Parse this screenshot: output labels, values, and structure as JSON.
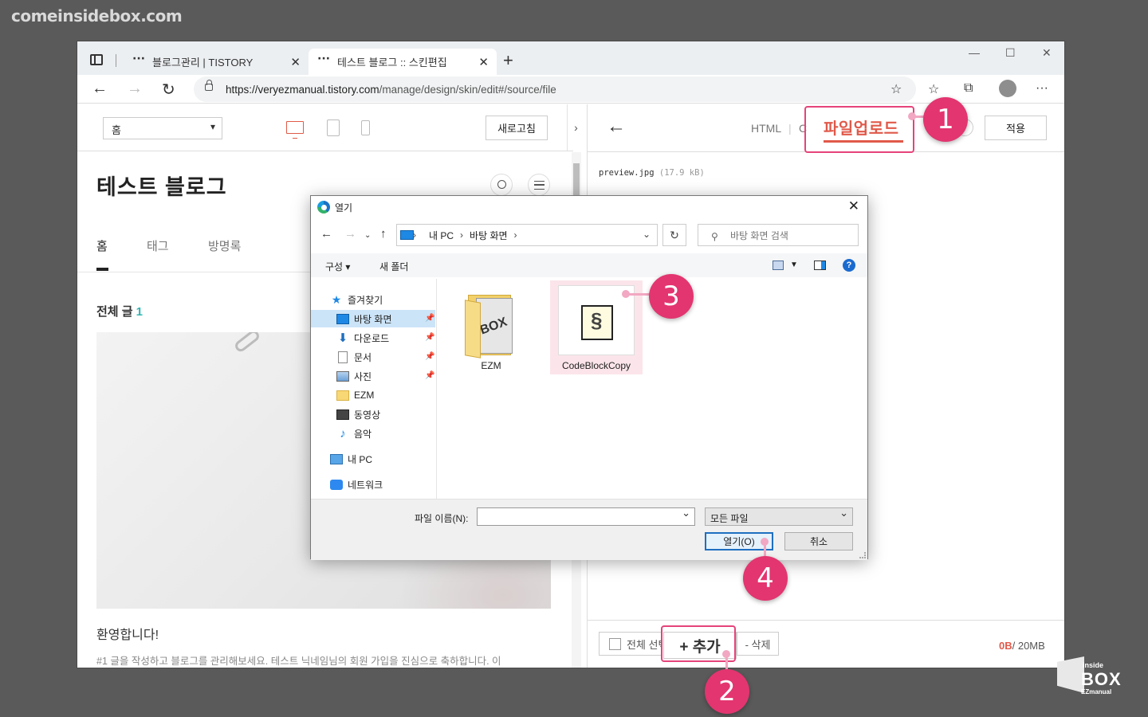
{
  "watermark": "comeinsidebox.com",
  "browser": {
    "tabs": [
      {
        "label": "블로그관리 | TISTORY",
        "active": false
      },
      {
        "label": "테스트 블로그 :: 스킨편집",
        "active": true
      }
    ],
    "url_host": "https://veryezmanual.tistory.com",
    "url_path": "/manage/design/skin/edit#/source/file"
  },
  "preview": {
    "page_select": "홈",
    "refresh_label": "새로고침",
    "blog_title": "테스트 블로그",
    "nav": [
      "홈",
      "태그",
      "방명록"
    ],
    "total_label": "전체 글",
    "total_count": "1",
    "welcome": "환영합니다!",
    "excerpt": "#1 글을 작성하고 블로그를 관리해보세요. 테스트 닉네임님의 회원 가입을 진심으로 축하합니다. 이"
  },
  "editor": {
    "modes": [
      "HTML",
      "C"
    ],
    "upload_tab": "파일업로드",
    "apply_label": "적용",
    "files": [
      {
        "name": "preview.jpg",
        "size": "(17.9 kB)"
      }
    ],
    "select_all": "전체 선택",
    "add_label": "+ 추가",
    "delete_label": "- 삭제",
    "storage_used": "0B",
    "storage_total": "/ 20MB"
  },
  "dialog": {
    "title": "열기",
    "path": [
      "내 PC",
      "바탕 화면"
    ],
    "search_placeholder": "바탕 화면 검색",
    "organize": "구성 ▾",
    "new_folder": "새 폴더",
    "sidebar": [
      {
        "label": "즐겨찾기",
        "icon": "star-icon"
      },
      {
        "label": "바탕 화면",
        "icon": "desktop-icon",
        "pinned": true,
        "selected": true
      },
      {
        "label": "다운로드",
        "icon": "download-icon",
        "pinned": true
      },
      {
        "label": "문서",
        "icon": "document-icon",
        "pinned": true
      },
      {
        "label": "사진",
        "icon": "pictures-icon",
        "pinned": true
      },
      {
        "label": "EZM",
        "icon": "folder-icon"
      },
      {
        "label": "동영상",
        "icon": "video-icon"
      },
      {
        "label": "음악",
        "icon": "music-icon"
      },
      {
        "label": "내 PC",
        "icon": "pc-icon"
      },
      {
        "label": "네트워크",
        "icon": "network-icon"
      }
    ],
    "items": [
      {
        "label": "EZM",
        "type": "folder"
      },
      {
        "label": "CodeBlockCopy",
        "type": "file",
        "selected": true
      }
    ],
    "filename_label": "파일 이름(N):",
    "filename_value": "",
    "filetype": "모든 파일",
    "open_label": "열기(O)",
    "cancel_label": "취소"
  },
  "annotations": {
    "colors": {
      "badge": "#e33570",
      "outline": "#e5447a"
    },
    "steps": [
      "1",
      "2",
      "3",
      "4"
    ]
  },
  "corner_logo": {
    "top": "inside",
    "main": "BOX",
    "sub": "EZmanual"
  }
}
